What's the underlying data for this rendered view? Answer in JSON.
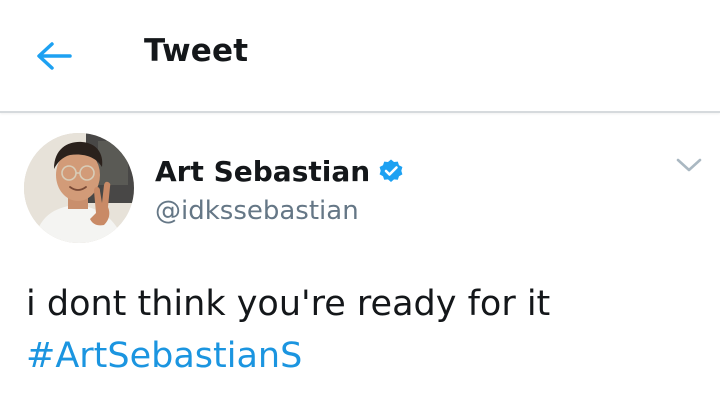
{
  "header": {
    "title": "Tweet",
    "back_icon": "back-arrow-icon",
    "accent_color": "#1da1f2"
  },
  "tweet": {
    "author_name": "Art Sebastian",
    "verified": true,
    "verified_icon": "verified-badge-icon",
    "handle": "@idkssebastian",
    "text": "i dont think you're ready for it",
    "hashtag": "#ArtSebastianS",
    "menu_icon": "chevron-down-icon",
    "hashtag_color": "#1b95e0",
    "handle_color": "#657786"
  }
}
